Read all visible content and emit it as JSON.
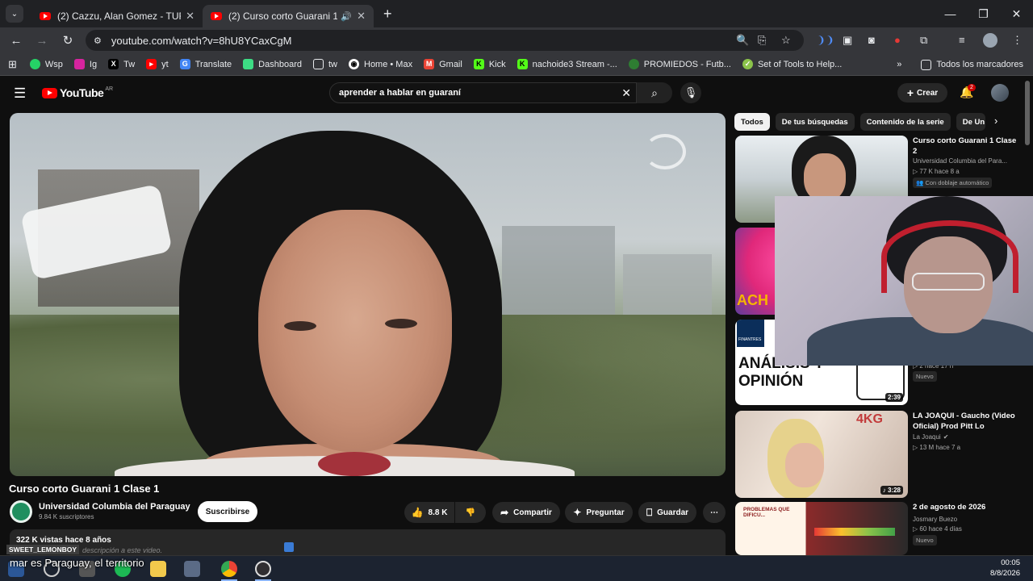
{
  "browser": {
    "tabs": [
      {
        "title": "(2) Cazzu, Alan Gomez - TURRA",
        "active": false
      },
      {
        "title": "(2) Curso corto Guarani 1 Cl",
        "active": true
      }
    ],
    "url": "youtube.com/watch?v=8hU8YCaxCgM",
    "bookmarks": [
      "Wsp",
      "Ig",
      "Tw",
      "yt",
      "Translate",
      "Dashboard",
      "tw",
      "Home • Max",
      "Gmail",
      "Kick",
      "nachoide3 Stream -...",
      "PROMIEDOS - Futb...",
      "Set of Tools to Help..."
    ],
    "all_bookmarks": "Todos los marcadores",
    "overflow": "»"
  },
  "youtube": {
    "logo": "YouTube",
    "country": "AR",
    "search_query": "aprender a hablar en guaraní",
    "create_label": "Crear",
    "notif_count": "2"
  },
  "video": {
    "title": "Curso corto Guarani 1 Clase 1",
    "channel": "Universidad Columbia del Paraguay",
    "subscribers": "9.84 K suscriptores",
    "subscribe_label": "Suscribirse",
    "likes": "8.8 K",
    "share_label": "Compartir",
    "ask_label": "Preguntar",
    "save_label": "Guardar",
    "views_line": "322 K vistas  hace 8 años",
    "description_placeholder": "descripción a este video."
  },
  "sidebar": {
    "chips": [
      "Todos",
      "De tus búsquedas",
      "Contenido de la serie",
      "De Un"
    ],
    "recs": [
      {
        "title": "Curso corto Guarani 1 Clase 2",
        "channel": "Universidad Columbia del Para...",
        "meta": "77 K  hace 8 a",
        "badge": "Con doblaje automático"
      },
      {
        "badge": "Nuevo",
        "meta": "2  hace 17 h",
        "thumb_text": "ACH"
      },
      {
        "duration": "2:39",
        "thumb_text": "ANÁLISIS Y OPINIÓN",
        "brand": "FINANTRES"
      },
      {
        "title": "LA JOAQUI - Gaucho (Video Oficial) Prod Pitt Lo",
        "channel": "La Joaqui",
        "meta": "13 M  hace 7 a",
        "duration": "3:28",
        "thumb_text": "4KG"
      },
      {
        "title": "2 de agosto de 2026",
        "channel": "Josmary Buezo",
        "meta": "60  hace 4 días",
        "badge": "Nuevo",
        "thumb_text": "PROBLEMAS QUE DIFICU..."
      }
    ]
  },
  "overlay": {
    "streamer_tag": "SWEET_LEMONBOY",
    "caption": "mar es Paraguay, el territorio"
  },
  "taskbar": {
    "time": "00:05",
    "date": "8/8/2026"
  }
}
